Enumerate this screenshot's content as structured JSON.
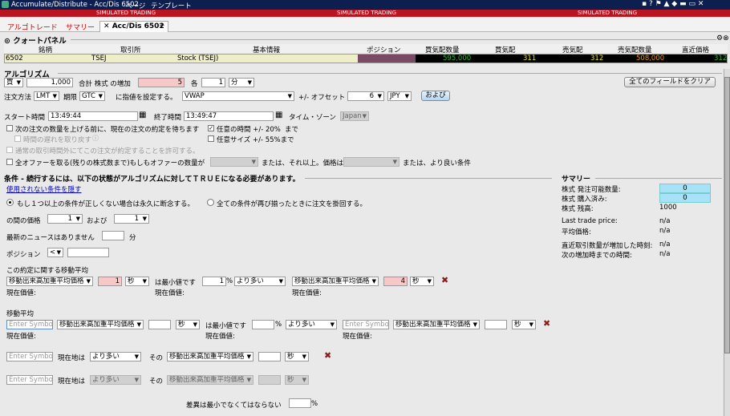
{
  "window": {
    "title": "Accumulate/Distribute - Acc/Dis 6502",
    "menu": [
      "ページ",
      "テンプレート"
    ],
    "simulated": "SIMULATED TRADING"
  },
  "tabs": {
    "algo": "アルゴトレード",
    "summary": "サマリー",
    "active": "Acc/Dis 6502",
    "add": "+"
  },
  "quote_panel": {
    "title": "クォートパネル",
    "headers": [
      "銘柄",
      "取引所",
      "基本情報",
      "ポジション",
      "買気配数量",
      "買気配",
      "売気配",
      "売気配数量",
      "直近価格"
    ],
    "row": {
      "symbol": "6502",
      "exchange": "TSEJ",
      "info": "Stock (TSEJ)",
      "position": "",
      "bid_size": "595,000",
      "bid": "311",
      "ask": "312",
      "ask_size": "508,000",
      "last": "312"
    }
  },
  "algorithm": {
    "title": "アルゴリズム",
    "side": "買",
    "quantity": "1,000",
    "total_label": "合計 株式 の増加",
    "increment": "5",
    "each_label": "各",
    "interval": "1",
    "interval_unit": "分",
    "clear_all": "全てのフィールドをクリア",
    "order_type_label": "注文方法",
    "order_type": "LMT",
    "tif_label": "期限",
    "tif": "GTC",
    "price_label": "に指値を設定する。",
    "price_type": "VWAP",
    "offset_label": "+/- オフセット",
    "offset": "6",
    "currency": "JPY",
    "and_button": "および",
    "start_label": "スタート時間",
    "start_time": "13:49:44",
    "end_label": "終了時間",
    "end_time": "13:49:47",
    "tz_label": "タイム・ゾーン",
    "timezone": "Japan",
    "opt_wait": "次の注文の数量を上げる前に、現在の注文の約定を待ちます",
    "opt_random_time": "任意の時間 +/- 20%",
    "until": "まで",
    "opt_time_delay": "時間の遅れを取り戻す",
    "opt_random_size": "任意サイズ +/- 55%まで",
    "opt_allow_outside": "通常の取引時間外にてこの注文が約定することを許可する。",
    "opt_take_all": "全オファーを取る(残りの株式数まで)もしもオファーの数量が",
    "or_more_price": "または、それ以上。価格は",
    "or_better": "または、より良い条件"
  },
  "conditions": {
    "title": "条件 - 続行するには、以下の状態がアルゴリズムに対してＴＲＵＥになる必要があります。",
    "hide_unused": "使用されない条件を隠す",
    "radio_halt": "もし１つ以上の条件が正しくない場合は永久に断念する。",
    "radio_resume": "全ての条件が再び揃ったときに注文を掛回する。",
    "price_between_label": "の間の価格",
    "price_from": "1",
    "and_label": "および",
    "price_to": "1",
    "no_news_label": "最新のニュースはありません",
    "news_minutes": "",
    "minutes_label": "分",
    "position_label": "ポジション",
    "position_op": "<",
    "position_value": "",
    "ma_section_label": "この約定に関する移動平均",
    "ma_type": "移動出来高加重平均価格",
    "ma_period1": "1",
    "ma_unit": "秒",
    "min_label": "は最小値です",
    "pct1": "1",
    "pct_sign": "%",
    "more_than": "より多い",
    "ma_period2": "4",
    "current_value_label": "現在価値:",
    "ma2_label": "移動平均",
    "symbol_placeholder": "Enter Symbol",
    "current_is_label": "現在地は",
    "its_label": "その",
    "diff_label": "差異は最小でなくてはならない"
  },
  "summary": {
    "title": "サマリー",
    "avail_label": "株式 発注可能数量:",
    "avail_value": "0",
    "bought_label": "株式 購入済み:",
    "bought_value": "0",
    "remaining_label": "株式 残高:",
    "remaining_value": "1000",
    "last_trade_label": "Last trade price:",
    "last_trade_value": "n/a",
    "avg_price_label": "平均価格:",
    "avg_price_value": "n/a",
    "last_inc_label": "直近取引数量が増加した時刻:",
    "last_inc_value": "n/a",
    "next_inc_label": "次の増加時までの時間:",
    "next_inc_value": "n/a"
  },
  "colors": {
    "titlebar": "#0d1f4e",
    "simulated": "#b9141f",
    "bid": "#22c322",
    "ask": "#e89a00",
    "summary_box": "#a8e2f8"
  }
}
